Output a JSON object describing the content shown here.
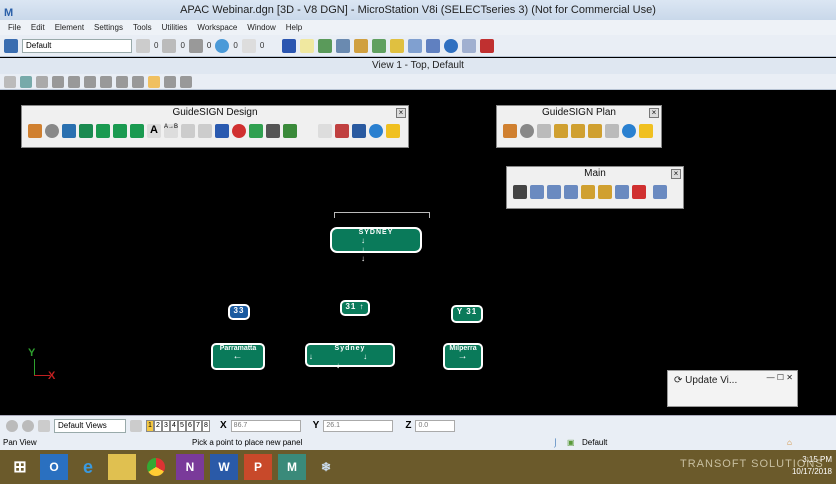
{
  "window": {
    "title": "APAC Webinar.dgn [3D - V8 DGN] - MicroStation V8i (SELECTseries 3) (Not for Commercial Use)"
  },
  "menu": [
    "File",
    "Edit",
    "Element",
    "Settings",
    "Tools",
    "Utilities",
    "Workspace",
    "Window",
    "Help"
  ],
  "attributes": {
    "level": "Default",
    "color": "0",
    "style": "0",
    "weight": "0",
    "transparency": "0",
    "priority": "0"
  },
  "view": {
    "title": "View 1 - Top, Default"
  },
  "panels": {
    "design": {
      "title": "GuideSIGN Design"
    },
    "plan": {
      "title": "GuideSIGN Plan"
    },
    "main": {
      "title": "Main"
    },
    "update": {
      "title": "Update Vi..."
    }
  },
  "signs": [
    {
      "text": "SYDNEY",
      "arrows": "↓ ↓ ↓"
    },
    {
      "text": "Parramatta",
      "arrows": "←"
    },
    {
      "text": "Sydney",
      "arrows": "↓ ↓ ↓"
    },
    {
      "text": "Milperra",
      "arrows": "→"
    },
    {
      "text": "33",
      "arrows": ""
    },
    {
      "text": "31 ↑",
      "arrows": ""
    },
    {
      "text": "Y 31",
      "arrows": ""
    }
  ],
  "axis": {
    "y": "Y",
    "x": "X"
  },
  "bottom": {
    "views_combo": "Default Views",
    "view_buttons": [
      "1",
      "2",
      "3",
      "4",
      "5",
      "6",
      "7",
      "8"
    ],
    "x_label": "X",
    "x_value": "86.7",
    "y_label": "Y",
    "y_value": "26.1",
    "z_label": "Z",
    "z_value": "0.0"
  },
  "status": {
    "tool": "Pan View",
    "prompt": "Pick a point to place new panel",
    "level": "Default"
  },
  "taskbar": {
    "watermark": "TRANSOFT SOLUTIONS",
    "time": "3:15 PM",
    "date": "10/17/2018"
  }
}
